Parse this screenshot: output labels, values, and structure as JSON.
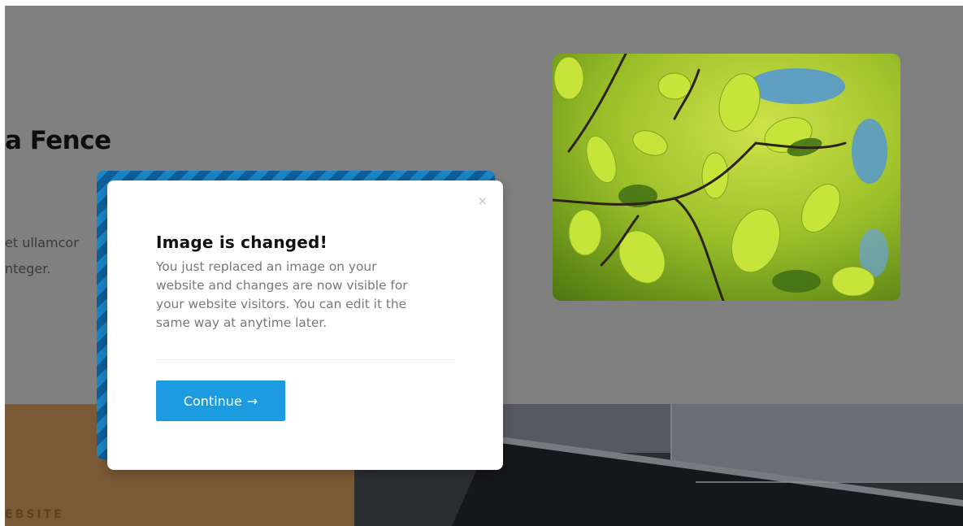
{
  "background_page": {
    "hero_title": "a Fence",
    "hero_text_line1": "et ullamcor",
    "hero_text_line2": "nteger.",
    "band_text": "EBSITE",
    "image_description": "green-leaves-photo"
  },
  "modal": {
    "close_symbol": "×",
    "title": "Image is changed!",
    "body_lines": [
      "You just replaced an image on your",
      "website and changes are now visible for",
      "your website visitors. You can edit it the",
      "same way at anytime later."
    ],
    "button_label": "Continue",
    "button_arrow": "→"
  },
  "colors": {
    "overlay": "#808080",
    "accent_blue": "#1d9be0",
    "stripe_dark": "#0e5f9b"
  }
}
